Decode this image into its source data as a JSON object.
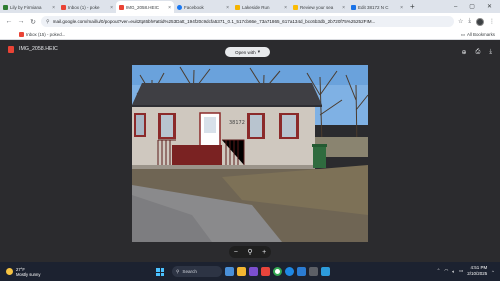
{
  "tabs": [
    {
      "label": "Lily by Firmiana",
      "favicon_color": "#2e7d32",
      "active": false
    },
    {
      "label": "Inbox (1) - poke",
      "favicon_color": "#ea4335",
      "active": false
    },
    {
      "label": "IMG_2058.HEIC",
      "favicon_color": "#ea4335",
      "active": true
    },
    {
      "label": "Facebook",
      "favicon_color": "#1877f2",
      "active": false
    },
    {
      "label": "Lakeside Run",
      "favicon_color": "#f4b400",
      "active": false
    },
    {
      "label": "Review your sea",
      "favicon_color": "#fbbc04",
      "active": false
    },
    {
      "label": "Edit 38172 N C",
      "favicon_color": "#1a73e8",
      "active": false
    }
  ],
  "address_bar": {
    "url": "mail.google.com/mail/u/0/popout?ver=euit2tpt6bh#attid%253Datt_194f20c9dcfa5371_0.1_517cb66e_73a71865_617a134d_bcc6b3db_2b720f75%25252FIM..."
  },
  "bookmarks": {
    "items": [
      {
        "label": "Inbox (15) - poked..."
      }
    ],
    "all_label": "All Bookmarks"
  },
  "viewer": {
    "file_name": "IMG_2058.HEIC",
    "open_with_label": "Open with",
    "zoom_out": "−",
    "zoom_icon": "magnifier-icon",
    "zoom_in": "+"
  },
  "photo": {
    "house_number": "38172"
  },
  "taskbar": {
    "temperature": "27°F",
    "condition": "Mostly sunny",
    "search_placeholder": "Search",
    "time": "4:51 PM",
    "date": "2/10/2025"
  }
}
